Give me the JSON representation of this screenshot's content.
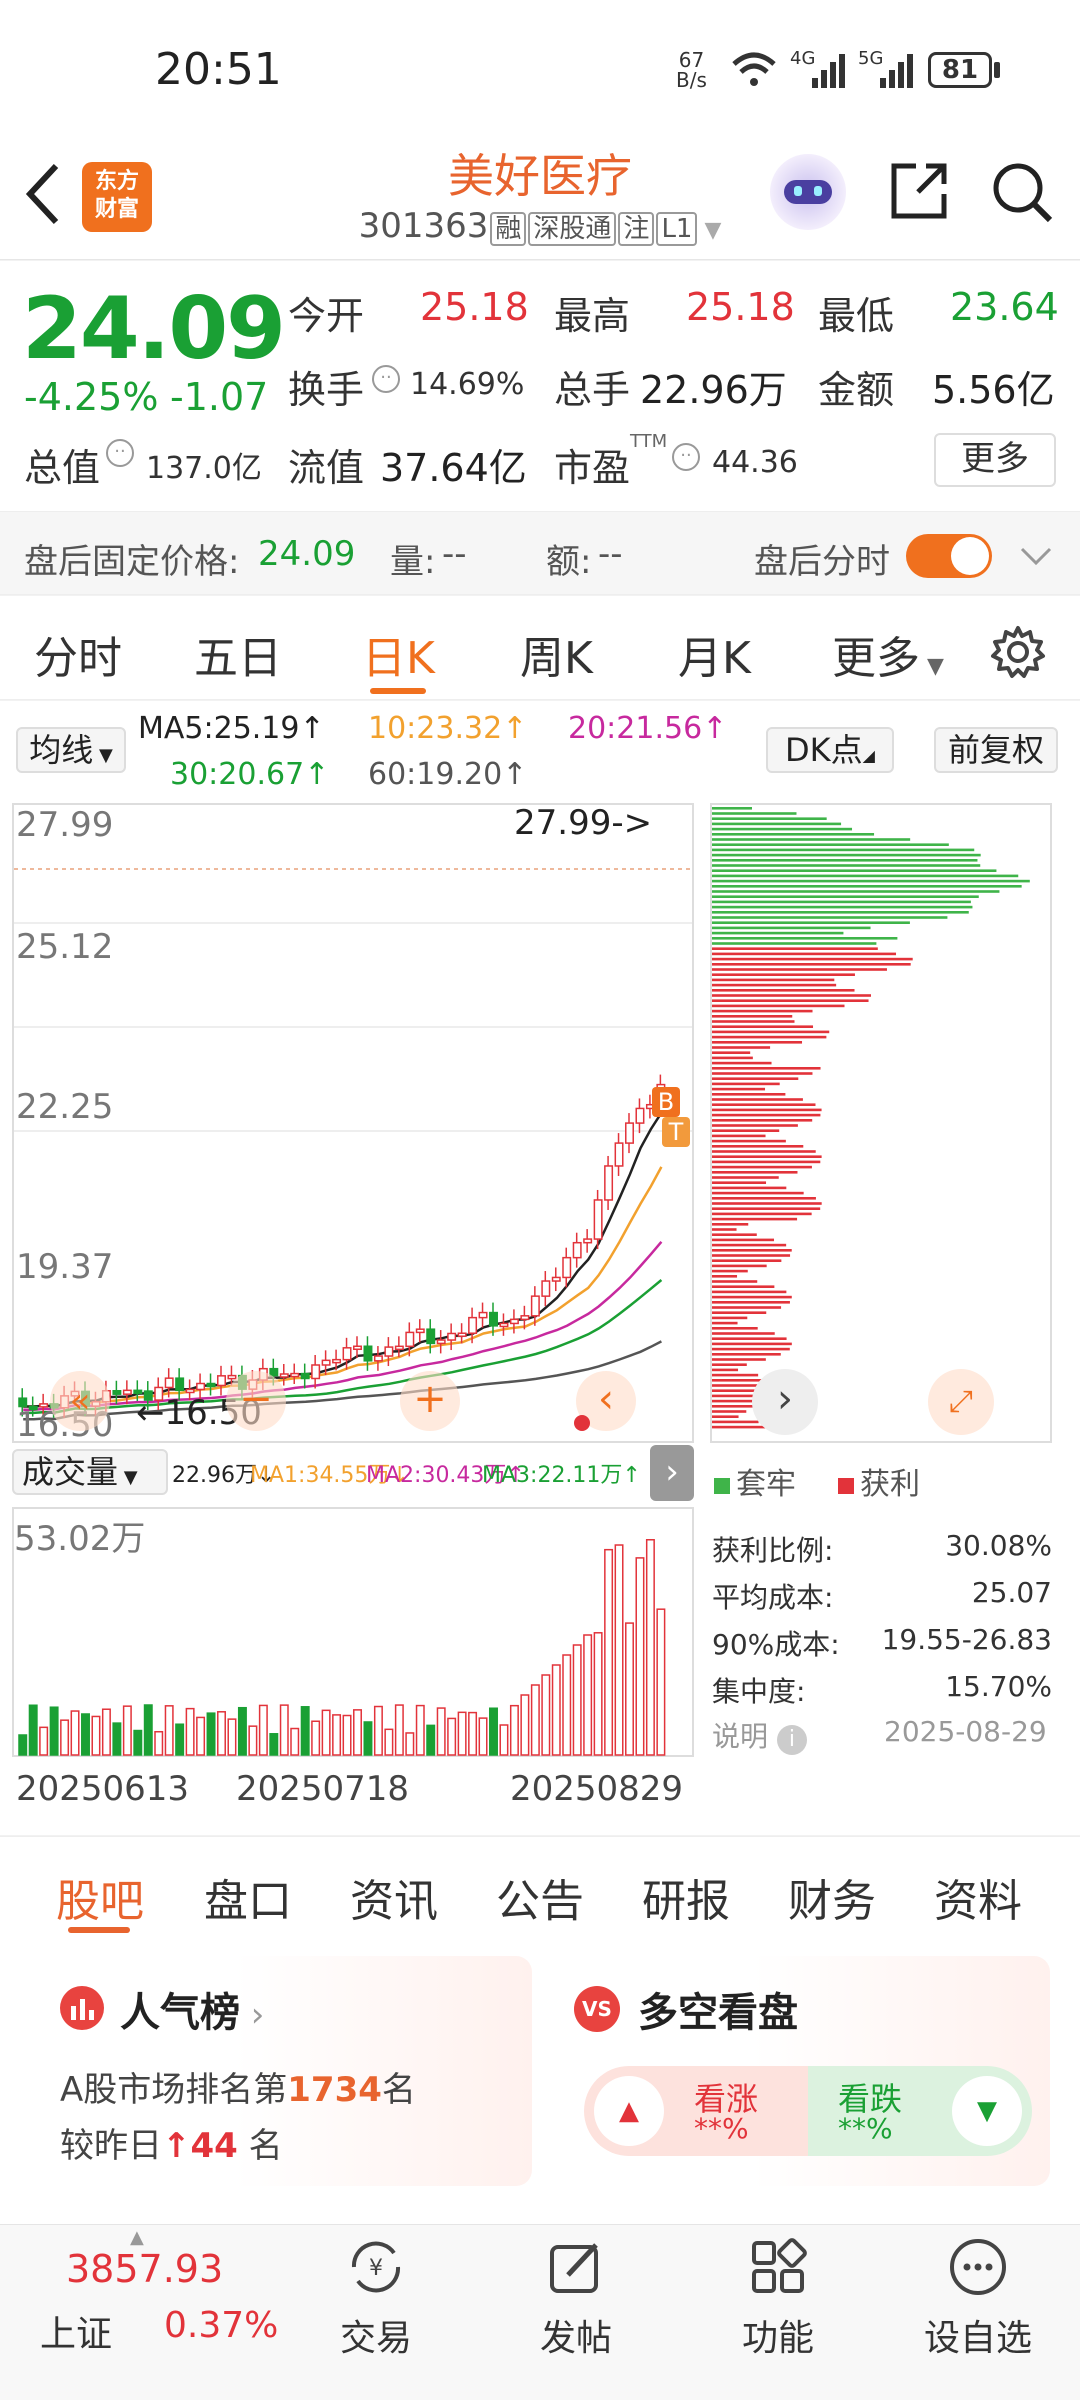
{
  "status": {
    "time": "20:51",
    "speed_top": "67",
    "speed_bottom": "B/s",
    "net1": "4G",
    "net2": "5G",
    "battery": "81"
  },
  "header": {
    "title": "美好医疗",
    "code": "301363",
    "tags": [
      "融",
      "深股通",
      "注",
      "L1"
    ],
    "logo_line1": "东方",
    "logo_line2": "财富"
  },
  "quote": {
    "price": "24.09",
    "change_pct": "-4.25%",
    "change": "-1.07",
    "open_label": "今开",
    "open": "25.18",
    "high_label": "最高",
    "high": "25.18",
    "low_label": "最低",
    "low": "23.64",
    "turnover_label": "换手",
    "turnover": "14.69%",
    "volume_label": "总手",
    "volume": "22.96万",
    "amount_label": "金额",
    "amount": "5.56亿",
    "mcap_label": "总值",
    "mcap": "137.0亿",
    "float_label": "流值",
    "float": "37.64亿",
    "pe_label": "市盈",
    "pe_sup": "TTM",
    "pe": "44.36",
    "more_button": "更多"
  },
  "afterhours": {
    "price_label": "盘后固定价格:",
    "price": "24.09",
    "vol_label": "量:",
    "vol": "--",
    "amt_label": "额:",
    "amt": "--",
    "toggle_label": "盘后分时"
  },
  "period_tabs": [
    "分时",
    "五日",
    "日K",
    "周K",
    "月K",
    "更多"
  ],
  "ma_legend": {
    "selector": "均线",
    "ma5": "MA5:25.19",
    "ma10": "10:23.32",
    "ma20": "20:21.56",
    "ma30": "30:20.67",
    "ma60": "60:19.20",
    "dk_button": "DK点",
    "adjust_button": "前复权"
  },
  "price_axis": [
    "27.99",
    "25.12",
    "22.25",
    "19.37",
    "16.50"
  ],
  "price_marks": {
    "high": "27.99->",
    "low": "16.50"
  },
  "signals": {
    "buy": "B",
    "sell": "T"
  },
  "vol_legend": {
    "selector": "成交量",
    "vol": "22.96万",
    "ma1": "MA1:34.55万",
    "ma2": "MA2:30.43万",
    "ma3": "MA3:22.11万"
  },
  "vol_axis_max": "53.02万",
  "dates": [
    "20250613",
    "20250718",
    "20250829"
  ],
  "chip": {
    "legend_trapped": "套牢",
    "legend_profit": "获利",
    "rows": [
      {
        "label": "获利比例:",
        "value": "30.08%"
      },
      {
        "label": "平均成本:",
        "value": "25.07"
      },
      {
        "label": "90%成本:",
        "value": "19.55-26.83"
      },
      {
        "label": "集中度:",
        "value": "15.70%"
      }
    ],
    "note_label": "说明",
    "date": "2025-08-29"
  },
  "function_tabs": [
    "股吧",
    "盘口",
    "资讯",
    "公告",
    "研报",
    "财务",
    "资料"
  ],
  "popularity": {
    "title": "人气榜",
    "line1_prefix": "A股市场排名第",
    "rank": "1734",
    "line1_suffix": "名",
    "line2_prefix": "较昨日",
    "delta": "44",
    "line2_suffix": "名"
  },
  "sentiment": {
    "title": "多空看盘",
    "rise_label": "看涨",
    "rise_value": "**%",
    "fall_label": "看跌",
    "fall_value": "**%"
  },
  "bottom": {
    "index_value": "3857.93",
    "index_name": "上证",
    "index_change": "0.37%",
    "trade": "交易",
    "post": "发帖",
    "functions": "功能",
    "watchlist": "设自选"
  },
  "colors": {
    "up": "#e2333a",
    "down": "#1aa034",
    "accent": "#f0701e"
  }
}
